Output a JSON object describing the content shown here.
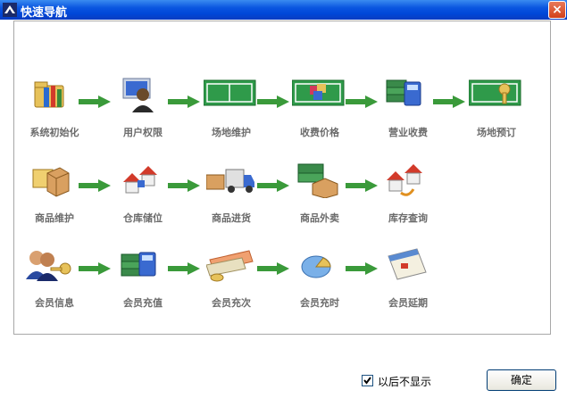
{
  "window": {
    "title": "快速导航",
    "close_label": "×"
  },
  "rows": [
    [
      "系统初始化",
      "用户权限",
      "场地维护",
      "收费价格",
      "营业收费",
      "场地预订"
    ],
    [
      "商品维护",
      "仓库储位",
      "商品进货",
      "商品外卖",
      "库存查询"
    ],
    [
      "会员信息",
      "会员充值",
      "会员充次",
      "会员充时",
      "会员延期"
    ]
  ],
  "footer": {
    "checkbox_label": "以后不显示",
    "checked": true,
    "ok_label": "确定"
  },
  "colors": {
    "titlebar": "#0a55e0",
    "arrow": "#3a9a3a",
    "label": "#6b6b6b"
  }
}
